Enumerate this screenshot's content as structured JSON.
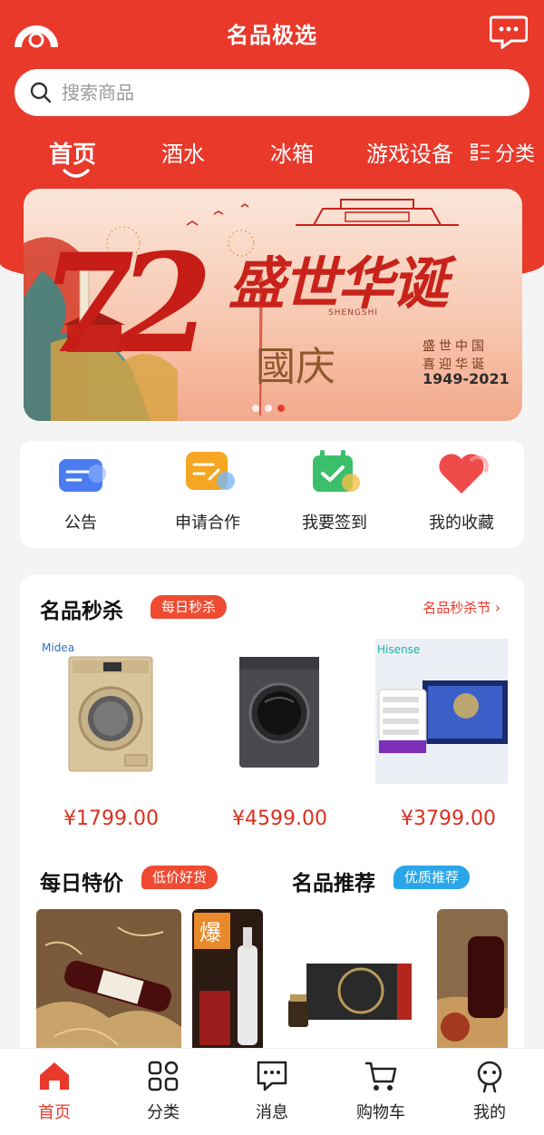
{
  "app": {
    "title": "名品极选"
  },
  "search": {
    "placeholder": "搜索商品"
  },
  "tabs": [
    {
      "label": "首页",
      "active": true
    },
    {
      "label": "酒水",
      "active": false
    },
    {
      "label": "冰箱",
      "active": false
    },
    {
      "label": "游戏设备",
      "active": false
    }
  ],
  "category_button": {
    "label": "分类",
    "icon": "grid-icon"
  },
  "banner": {
    "big_number": "72",
    "headline": "盛世华诞",
    "subtitle": "國庆",
    "mark": "SHENGSHI",
    "side_text_line1": "盛世中国",
    "side_text_line2": "喜迎华诞",
    "years": "1949-2021",
    "dots": 3,
    "active_dot": 2
  },
  "quick_actions": [
    {
      "label": "公告",
      "icon": "announcement-icon",
      "color": "#4a7cf0"
    },
    {
      "label": "申请合作",
      "icon": "apply-icon",
      "color": "#f5a623"
    },
    {
      "label": "我要签到",
      "icon": "checkin-icon",
      "color": "#3cbf6b"
    },
    {
      "label": "我的收藏",
      "icon": "heart-icon",
      "color": "#f04b4b"
    }
  ],
  "flash_sale": {
    "title": "名品秒杀",
    "badge": "每日秒杀",
    "more": "名品秒杀节 ›",
    "products": [
      {
        "brand": "Midea",
        "price": "¥1799.00"
      },
      {
        "brand": "",
        "price": "¥4599.00"
      },
      {
        "brand": "Hisense",
        "price": "¥3799.00"
      }
    ]
  },
  "daily_deals": {
    "title": "每日特价",
    "badge": "低价好货",
    "thumb_text": "爆"
  },
  "recommend": {
    "title": "名品推荐",
    "badge": "优质推荐"
  },
  "nav": [
    {
      "label": "首页",
      "icon": "home-icon",
      "active": true
    },
    {
      "label": "分类",
      "icon": "category-icon",
      "active": false
    },
    {
      "label": "消息",
      "icon": "message-icon",
      "active": false
    },
    {
      "label": "购物车",
      "icon": "cart-icon",
      "active": false
    },
    {
      "label": "我的",
      "icon": "profile-icon",
      "active": false
    }
  ],
  "colors": {
    "brand": "#e8392b",
    "price": "#d9301f",
    "blue_badge": "#2aa6e8"
  }
}
